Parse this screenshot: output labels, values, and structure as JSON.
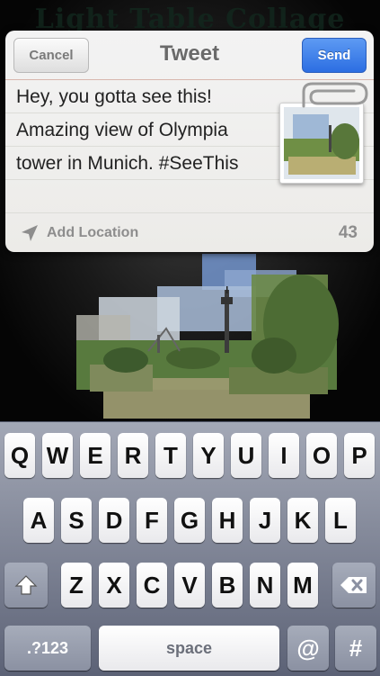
{
  "background_app": {
    "title": "Light Table Collage"
  },
  "tweet_sheet": {
    "cancel_label": "Cancel",
    "title": "Tweet",
    "send_label": "Send",
    "text_lines": [
      "Hey, you gotta see this!",
      "Amazing view of Olympia",
      "tower in Munich. #SeeThis"
    ],
    "location_label": "Add Location",
    "char_count": "43",
    "attachment_icon": "photo-thumbnail"
  },
  "keyboard": {
    "row1": [
      "Q",
      "W",
      "E",
      "R",
      "T",
      "Y",
      "U",
      "I",
      "O",
      "P"
    ],
    "row2": [
      "A",
      "S",
      "D",
      "F",
      "G",
      "H",
      "J",
      "K",
      "L"
    ],
    "row3": [
      "Z",
      "X",
      "C",
      "V",
      "B",
      "N",
      "M"
    ],
    "shift_icon": "shift-arrow-icon",
    "delete_icon": "backspace-icon",
    "numbers_label": ".?123",
    "space_label": "space",
    "at_label": "@",
    "hash_label": "#"
  },
  "colors": {
    "send_button": "#2c6ee2",
    "keyboard_bg": "#8a8fa0"
  }
}
